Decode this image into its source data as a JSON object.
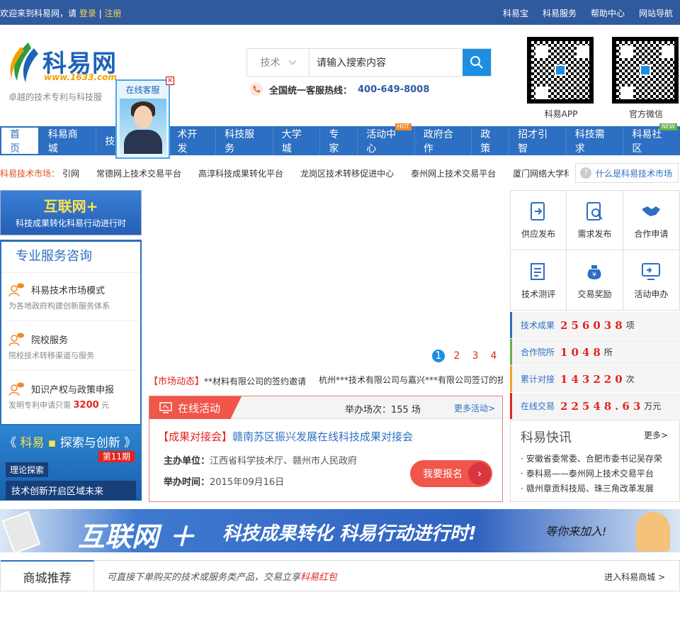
{
  "topbar": {
    "welcome_prefix": "欢迎来到科易网，请 ",
    "login": "登录",
    "sep": " | ",
    "register": "注册",
    "links": [
      "科易宝",
      "科易服务",
      "帮助中心",
      "网站导航"
    ]
  },
  "logo": {
    "name": "科易网",
    "url": "www.1633.com",
    "slogan": "卓越的技术专利与科技服"
  },
  "search": {
    "category": "技术",
    "placeholder": "请输入搜索内容"
  },
  "hotline": {
    "label": "全国统一客服热线：",
    "number": "400-649-8008"
  },
  "qr": [
    {
      "label": "科易APP"
    },
    {
      "label": "官方微信"
    }
  ],
  "kefu": {
    "title": "在线客服"
  },
  "nav": {
    "items": [
      "首页",
      "科易商城",
      "技",
      "术开发",
      "科技服务",
      "大学城",
      "专家",
      "活动中心",
      "政府合作",
      "政策",
      "招才引智",
      "科技需求",
      "科易社区"
    ],
    "hot_badge": "HOT",
    "new_badge": "NEW"
  },
  "market": {
    "label": "科易技术市场：",
    "items": [
      "引网",
      "常德网上技术交易平台",
      "高淳科技成果转化平台",
      "龙岗区技术转移促进中心",
      "泰州网上技术交易平台",
      "厦门网络大学科技"
    ],
    "what": "什么是科易技术市场"
  },
  "left_banner": {
    "a": "互联网+",
    "b": "科技成果转化科易行动进行时"
  },
  "consult": {
    "title": "专业服务咨询",
    "items": [
      {
        "title": "科易技术市场模式",
        "sub": "为各地政府构建创新服务体系"
      },
      {
        "title": "院校服务",
        "sub": "院校技术转移渠道与服务"
      },
      {
        "title": "知识产权与政策申报",
        "sub": "发明专利申请只需 ",
        "price": "3200",
        "unit": " 元"
      }
    ]
  },
  "explore": {
    "title_l": "《 ",
    "title_c": "科易",
    "title_dot": " ▪ ",
    "title_r": "探索与创新 》",
    "period": "第11期",
    "tag": "理论探索",
    "bottom": "技术创新开启区域未来"
  },
  "slider": {
    "pages": [
      "1",
      "2",
      "3",
      "4"
    ]
  },
  "dynamics": {
    "label": "【市场动态】",
    "items": [
      "**材料有限公司的签约邀请",
      "杭州***技术有限公司与嘉兴***有限公司签订的技"
    ]
  },
  "activity": {
    "tab": "在线活动",
    "count_label": "举办场次：",
    "count": "155",
    "count_unit": " 场",
    "more": "更多活动>",
    "title_tag": "【成果对接会】",
    "title": "赣南苏区振兴发展在线科技成果对接会",
    "org_label": "主办单位：",
    "org": "江西省科学技术厅、赣州市人民政府",
    "date_label": "举办时间：",
    "date": "2015年09月16日",
    "signup": "我要报名"
  },
  "actions": [
    {
      "label": "供应发布",
      "icon": "supply-icon"
    },
    {
      "label": "需求发布",
      "icon": "demand-icon"
    },
    {
      "label": "合作申请",
      "icon": "handshake-icon"
    },
    {
      "label": "技术测评",
      "icon": "evaluation-icon"
    },
    {
      "label": "交易奖励",
      "icon": "reward-icon"
    },
    {
      "label": "活动申办",
      "icon": "activity-icon"
    }
  ],
  "stats": [
    {
      "label": "技术成果",
      "value": "256038",
      "unit": "项"
    },
    {
      "label": "合作院所",
      "value": "1048",
      "unit": "所"
    },
    {
      "label": "累计对接",
      "value": "143220",
      "unit": "次"
    },
    {
      "label": "在线交易",
      "value": "22548.63",
      "unit": "万元"
    }
  ],
  "news": {
    "title": "科易快讯",
    "more": "更多>",
    "items": [
      "安徽省委常委、合肥市委书记吴存荣",
      "泰科易——泰州网上技术交易平台",
      "赣州章贡科技局、珠三角改革发展"
    ]
  },
  "bigbanner": {
    "a": "互联网 ＋",
    "b": "科技成果转化 科易行动进行时!",
    "c": "等你来加入!"
  },
  "mall": {
    "title": "商城推荐",
    "desc_a": "可直接下单购买的技术或服务类产品，交易立享",
    "desc_red": "科易红包",
    "enter": "进入科易商城 >"
  },
  "colors": {
    "brand_blue": "#2d6fc2",
    "accent_red": "#e2261f",
    "topbar": "#2f5a9e"
  }
}
